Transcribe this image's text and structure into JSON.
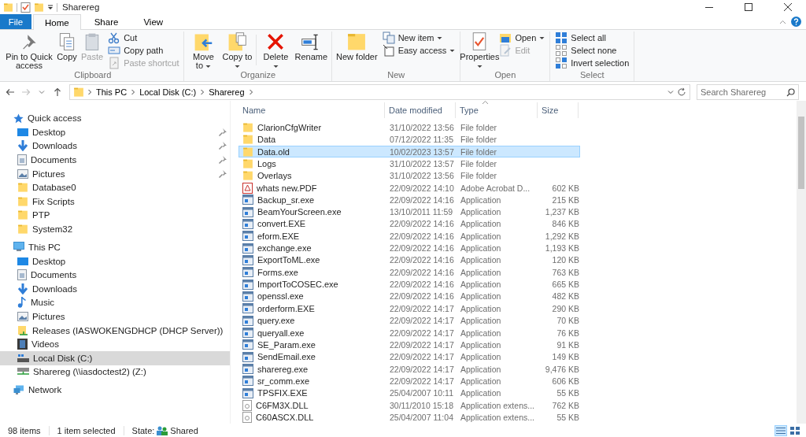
{
  "title_bar": {
    "title": "Sharereg"
  },
  "file_tab": {
    "label": "File"
  },
  "tabs": [
    {
      "label": "Home",
      "selected": true
    },
    {
      "label": "Share",
      "selected": false
    },
    {
      "label": "View",
      "selected": false
    }
  ],
  "ribbon": {
    "groups": [
      {
        "label": "Clipboard",
        "items": [
          {
            "kind": "large",
            "label": "Pin to Quick access",
            "dropdown": false,
            "disabled": false
          },
          {
            "kind": "large",
            "label": "Copy",
            "dropdown": false,
            "disabled": false
          },
          {
            "kind": "large",
            "label": "Paste",
            "dropdown": false,
            "disabled": true
          },
          {
            "kind": "stack",
            "items": [
              {
                "label": "Cut",
                "dropdown": false,
                "disabled": false
              },
              {
                "label": "Copy path",
                "dropdown": false,
                "disabled": false
              },
              {
                "label": "Paste shortcut",
                "dropdown": false,
                "disabled": true
              }
            ]
          }
        ]
      },
      {
        "label": "Organize",
        "items": [
          {
            "kind": "large",
            "label": "Move to",
            "dropdown": true,
            "disabled": false
          },
          {
            "kind": "large",
            "label": "Copy to",
            "dropdown": true,
            "disabled": false
          },
          {
            "kind": "separator"
          },
          {
            "kind": "large",
            "label": "Delete",
            "dropdown": true,
            "disabled": false
          },
          {
            "kind": "large",
            "label": "Rename",
            "dropdown": false,
            "disabled": false
          }
        ]
      },
      {
        "label": "New",
        "items": [
          {
            "kind": "large",
            "label": "New folder",
            "dropdown": false,
            "disabled": false
          },
          {
            "kind": "stack",
            "items": [
              {
                "label": "New item",
                "dropdown": true,
                "disabled": false
              },
              {
                "label": "Easy access",
                "dropdown": true,
                "disabled": false
              }
            ]
          }
        ]
      },
      {
        "label": "Open",
        "items": [
          {
            "kind": "large",
            "label": "Properties",
            "dropdown": true,
            "disabled": false
          },
          {
            "kind": "stack",
            "items": [
              {
                "label": "Open",
                "dropdown": true,
                "disabled": false
              },
              {
                "label": "Edit",
                "dropdown": false,
                "disabled": true
              }
            ]
          }
        ]
      },
      {
        "label": "Select",
        "items": [
          {
            "kind": "stack",
            "items": [
              {
                "label": "Select all",
                "dropdown": false,
                "disabled": false
              },
              {
                "label": "Select none",
                "dropdown": false,
                "disabled": false
              },
              {
                "label": "Invert selection",
                "dropdown": false,
                "disabled": false
              }
            ]
          }
        ]
      }
    ]
  },
  "address_bar": {
    "forward_disabled": true,
    "path": [
      "This PC",
      "Local Disk (C:)",
      "Sharereg"
    ]
  },
  "search": {
    "placeholder": "Search Sharereg"
  },
  "sidebar": {
    "sections": [
      {
        "label": "Quick access",
        "kind": "star",
        "items": [
          {
            "label": "Desktop",
            "kind": "desktop",
            "pinned": true,
            "selected": false
          },
          {
            "label": "Downloads",
            "kind": "downloads",
            "pinned": true,
            "selected": false
          },
          {
            "label": "Documents",
            "kind": "documents",
            "pinned": true,
            "selected": false
          },
          {
            "label": "Pictures",
            "kind": "pictures",
            "pinned": true,
            "selected": false
          },
          {
            "label": "Database0",
            "kind": "folder",
            "pinned": false,
            "selected": false
          },
          {
            "label": "Fix Scripts",
            "kind": "folder",
            "pinned": false,
            "selected": false
          },
          {
            "label": "PTP",
            "kind": "folder",
            "pinned": false,
            "selected": false
          },
          {
            "label": "System32",
            "kind": "folder",
            "pinned": false,
            "selected": false
          }
        ]
      },
      {
        "label": "This PC",
        "kind": "pc",
        "items": [
          {
            "label": "Desktop",
            "kind": "desktop",
            "pinned": false,
            "selected": false
          },
          {
            "label": "Documents",
            "kind": "documents",
            "pinned": false,
            "selected": false
          },
          {
            "label": "Downloads",
            "kind": "downloads",
            "pinned": false,
            "selected": false
          },
          {
            "label": "Music",
            "kind": "music",
            "pinned": false,
            "selected": false
          },
          {
            "label": "Pictures",
            "kind": "pictures",
            "pinned": false,
            "selected": false
          },
          {
            "label": "Releases (IASWOKENGDHCP (DHCP Server))",
            "kind": "share",
            "pinned": false,
            "selected": false
          },
          {
            "label": "Videos",
            "kind": "videos",
            "pinned": false,
            "selected": false
          },
          {
            "label": "Local Disk (C:)",
            "kind": "drive",
            "pinned": false,
            "selected": true
          },
          {
            "label": "Sharereg (\\\\iasdoctest2) (Z:)",
            "kind": "netdrive",
            "pinned": false,
            "selected": false
          }
        ]
      },
      {
        "label": "Network",
        "kind": "network"
      }
    ]
  },
  "table": {
    "columns": [
      {
        "label": "Name",
        "sorted": false
      },
      {
        "label": "Date modified",
        "sorted": false
      },
      {
        "label": "Type",
        "sorted": true
      },
      {
        "label": "Size",
        "sorted": false
      }
    ],
    "rows": [
      {
        "name": "ClarionCfgWriter",
        "date": "31/10/2022 13:56",
        "type": "File folder",
        "kind": "folder",
        "selected": false
      },
      {
        "name": "Data",
        "date": "07/12/2022 11:35",
        "type": "File folder",
        "kind": "folder",
        "selected": false
      },
      {
        "name": "Data.old",
        "date": "10/02/2023 13:57",
        "type": "File folder",
        "kind": "folder",
        "selected": true
      },
      {
        "name": "Logs",
        "date": "31/10/2022 13:57",
        "type": "File folder",
        "kind": "folder",
        "selected": false
      },
      {
        "name": "Overlays",
        "date": "31/10/2022 13:56",
        "type": "File folder",
        "kind": "folder",
        "selected": false
      },
      {
        "name": "whats new.PDF",
        "date": "22/09/2022 14:10",
        "type": "Adobe Acrobat D...",
        "size": "602 KB",
        "kind": "pdf",
        "selected": false
      },
      {
        "name": "Backup_sr.exe",
        "date": "22/09/2022 14:16",
        "type": "Application",
        "size": "215 KB",
        "kind": "app",
        "selected": false
      },
      {
        "name": "BeamYourScreen.exe",
        "date": "13/10/2011 11:59",
        "type": "Application",
        "size": "1,237 KB",
        "kind": "app",
        "selected": false
      },
      {
        "name": "convert.EXE",
        "date": "22/09/2022 14:16",
        "type": "Application",
        "size": "846 KB",
        "kind": "app",
        "selected": false
      },
      {
        "name": "eform.EXE",
        "date": "22/09/2022 14:16",
        "type": "Application",
        "size": "1,292 KB",
        "kind": "app",
        "selected": false
      },
      {
        "name": "exchange.exe",
        "date": "22/09/2022 14:16",
        "type": "Application",
        "size": "1,193 KB",
        "kind": "app",
        "selected": false
      },
      {
        "name": "ExportToML.exe",
        "date": "22/09/2022 14:16",
        "type": "Application",
        "size": "120 KB",
        "kind": "app",
        "selected": false
      },
      {
        "name": "Forms.exe",
        "date": "22/09/2022 14:16",
        "type": "Application",
        "size": "763 KB",
        "kind": "app",
        "selected": false
      },
      {
        "name": "ImportToCOSEC.exe",
        "date": "22/09/2022 14:16",
        "type": "Application",
        "size": "665 KB",
        "kind": "app",
        "selected": false
      },
      {
        "name": "openssl.exe",
        "date": "22/09/2022 14:16",
        "type": "Application",
        "size": "482 KB",
        "kind": "app",
        "selected": false
      },
      {
        "name": "orderform.EXE",
        "date": "22/09/2022 14:17",
        "type": "Application",
        "size": "290 KB",
        "kind": "app",
        "selected": false
      },
      {
        "name": "query.exe",
        "date": "22/09/2022 14:17",
        "type": "Application",
        "size": "70 KB",
        "kind": "app",
        "selected": false
      },
      {
        "name": "queryall.exe",
        "date": "22/09/2022 14:17",
        "type": "Application",
        "size": "76 KB",
        "kind": "app",
        "selected": false
      },
      {
        "name": "SE_Param.exe",
        "date": "22/09/2022 14:17",
        "type": "Application",
        "size": "91 KB",
        "kind": "app",
        "selected": false
      },
      {
        "name": "SendEmail.exe",
        "date": "22/09/2022 14:17",
        "type": "Application",
        "size": "149 KB",
        "kind": "app",
        "selected": false
      },
      {
        "name": "sharereg.exe",
        "date": "22/09/2022 14:17",
        "type": "Application",
        "size": "9,476 KB",
        "kind": "app",
        "selected": false
      },
      {
        "name": "sr_comm.exe",
        "date": "22/09/2022 14:17",
        "type": "Application",
        "size": "606 KB",
        "kind": "app",
        "selected": false
      },
      {
        "name": "TPSFIX.EXE",
        "date": "25/04/2007 10:11",
        "type": "Application",
        "size": "55 KB",
        "kind": "app",
        "selected": false
      },
      {
        "name": "C6FM3X.DLL",
        "date": "30/11/2010 15:18",
        "type": "Application extens...",
        "size": "762 KB",
        "kind": "dll",
        "selected": false
      },
      {
        "name": "C60ASCX.DLL",
        "date": "25/04/2007 11:04",
        "type": "Application extens...",
        "size": "55 KB",
        "kind": "dll",
        "selected": false
      }
    ]
  },
  "status_bar": {
    "items": "98 items",
    "selection": "1 item selected",
    "state_label": "State:",
    "state_value": "Shared",
    "views": [
      {
        "selected": true
      },
      {
        "selected": false
      }
    ]
  }
}
